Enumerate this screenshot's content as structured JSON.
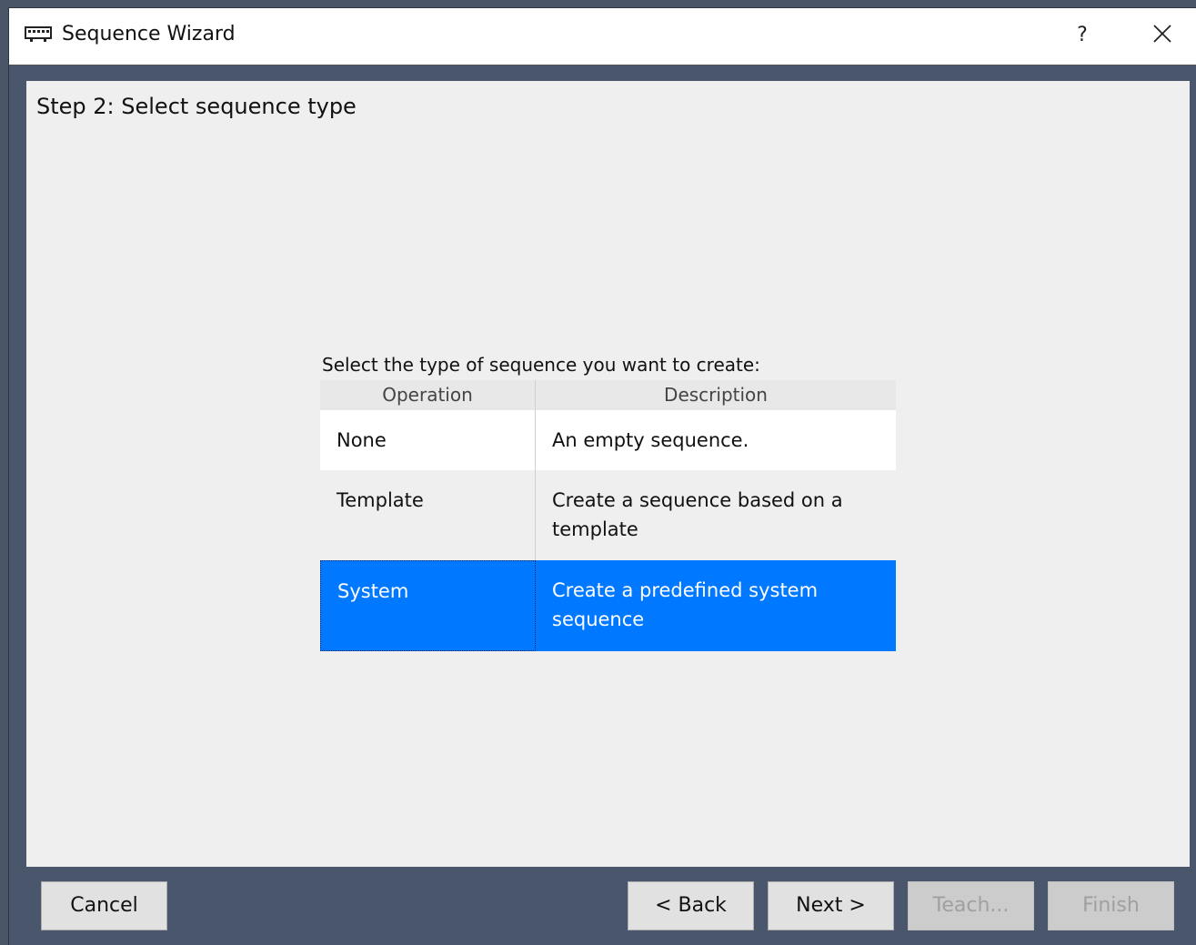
{
  "window": {
    "title": "Sequence Wizard",
    "help_label": "?",
    "close_icon": "close-icon",
    "app_icon": "keyboard-icon"
  },
  "wizard": {
    "step_title": "Step 2: Select sequence type",
    "prompt": "Select the type of sequence you want to create:",
    "columns": [
      "Operation",
      "Description"
    ],
    "rows": [
      {
        "operation": "None",
        "description": "An empty sequence.",
        "selected": false
      },
      {
        "operation": "Template",
        "description": "Create a sequence based on a template",
        "selected": false
      },
      {
        "operation": "System",
        "description": "Create a predefined system sequence",
        "selected": true
      }
    ],
    "selection_color": "#0078ff"
  },
  "buttons": {
    "cancel": "Cancel",
    "back": "< Back",
    "next": "Next >",
    "teach": "Teach...",
    "finish": "Finish"
  }
}
